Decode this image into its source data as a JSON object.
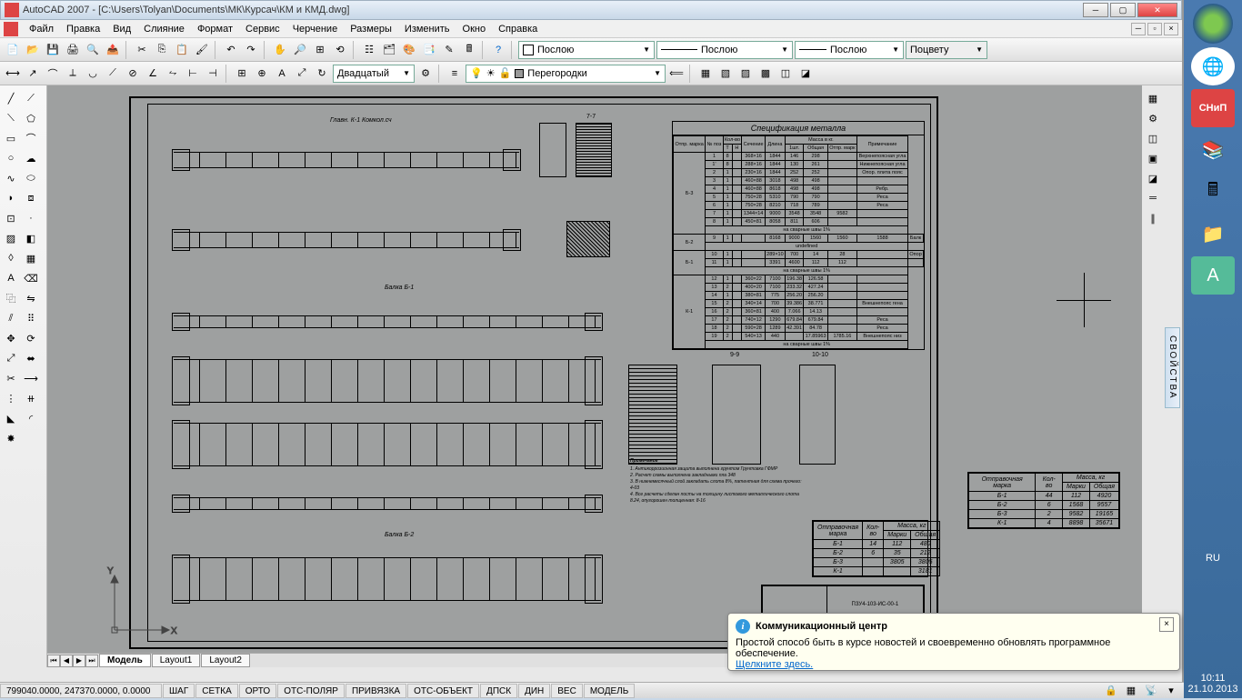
{
  "titlebar": {
    "text": "AutoCAD 2007 - [C:\\Users\\Tolyan\\Documents\\МК\\Курсач\\КМ и КМД.dwg]"
  },
  "menu": [
    "Файл",
    "Правка",
    "Вид",
    "Слияние",
    "Формат",
    "Сервис",
    "Черчение",
    "Размеры",
    "Изменить",
    "Окно",
    "Справка"
  ],
  "properties_row": {
    "color": "Послою",
    "linetype": "Послою",
    "lineweight": "Послою",
    "plotstyle": "Поцвету"
  },
  "layer_row": {
    "dimstyle": "Двадцатый",
    "layer": "Перегородки"
  },
  "tabs": [
    "Модель",
    "Layout1",
    "Layout2"
  ],
  "active_tab": 0,
  "status": {
    "coords": "799040.0000, 247370.0000, 0.0000",
    "toggles": [
      "ШАГ",
      "СЕТКА",
      "ОРТО",
      "ОТС-ПОЛЯР",
      "ПРИВЯЗКА",
      "ОТС-ОБЪЕКТ",
      "ДПСК",
      "ДИН",
      "ВЕС",
      "МОДЕЛЬ"
    ]
  },
  "notification": {
    "title": "Коммуникационный центр",
    "body": "Простой способ быть в курсе новостей и своевременно обновлять программное обеспечение.",
    "link": "Щелкните здесь."
  },
  "properties_panel": "СВОЙСТВА",
  "clock": {
    "time": "10:11",
    "date": "21.10.2013"
  },
  "lang": "RU",
  "drawing": {
    "spec_title": "Спецификация металла",
    "spec_headers": [
      "Отпр. марка",
      "№ поз",
      "Кол-во",
      "",
      "Сечение",
      "Длина",
      "Масса в кг.",
      "",
      "",
      "Примечание"
    ],
    "spec_sub_headers": [
      "",
      "",
      "Т",
      "Н",
      "",
      "",
      "1шт.",
      "Общая",
      "Отпр. марк",
      ""
    ],
    "spec_groups": [
      {
        "mark": "Б-3",
        "rows": [
          [
            "1",
            "8",
            "",
            "368×16",
            "1844",
            "146",
            "298",
            "",
            "Верхнепоясная угла"
          ],
          [
            "1'",
            "8",
            "",
            "288×16",
            "1844",
            "130",
            "261",
            "",
            "Нижнепоясная угла"
          ],
          [
            "2",
            "1",
            "",
            "230×16",
            "1844",
            "252",
            "252",
            "",
            "Опор. плита пояс"
          ],
          [
            "3",
            "1",
            "",
            "460×88",
            "3018",
            "498",
            "498",
            "",
            ""
          ],
          [
            "4",
            "1",
            "",
            "460×88",
            "8618",
            "498",
            "498",
            "",
            "Ребр."
          ],
          [
            "5",
            "1",
            "",
            "750×28",
            "5310",
            "790",
            "790",
            "",
            "Реса"
          ],
          [
            "6",
            "1",
            "",
            "750×28",
            "8210",
            "718",
            "789",
            "",
            "Реса"
          ],
          [
            "7",
            "1",
            "",
            "1344×14",
            "9000",
            "3548",
            "3548",
            "9582",
            ""
          ],
          [
            "8",
            "1",
            "",
            "450×81",
            "8058",
            "811",
            "606",
            "",
            ""
          ]
        ],
        "footer": "на сварные швы 1%"
      },
      {
        "mark": "Б-2",
        "rows": [
          [
            "9",
            "1",
            "",
            "",
            "8168",
            "9000",
            "1560",
            "1560",
            "1588",
            "Балк"
          ]
        ]
      },
      {
        "mark": "Б-1",
        "rows": [
          [
            "10",
            "1",
            "",
            "",
            "289×10",
            "700",
            "14",
            "28",
            "",
            "Опор"
          ],
          [
            "11",
            "1",
            "",
            "",
            "3391",
            "4600",
            "112",
            "112",
            "",
            ""
          ]
        ],
        "footer": "на сварные швы 1%"
      },
      {
        "mark": "К-1",
        "rows": [
          [
            "12",
            "1",
            "",
            "360×22",
            "7100",
            "196.38",
            "126.58",
            "",
            ""
          ],
          [
            "13",
            "2",
            "",
            "400×20",
            "7100",
            "233.32",
            "427.24",
            "",
            ""
          ],
          [
            "14",
            "1",
            "",
            "380×81",
            "775",
            "256.20",
            "256.20",
            "",
            ""
          ],
          [
            "15",
            "2",
            "",
            "340×14",
            "700",
            "39.386",
            "38.771",
            "",
            "Внешнепояс гена"
          ],
          [
            "16",
            "2",
            "",
            "360×81",
            "400",
            "7.066",
            "14.13",
            "",
            ""
          ],
          [
            "17",
            "2",
            "",
            "740×12",
            "1290",
            "679.84",
            "679.84",
            "",
            "Реса"
          ],
          [
            "18",
            "2",
            "",
            "590×28",
            "1289",
            "42.391",
            "84.78",
            "",
            "Реса"
          ],
          [
            "19",
            "2",
            "",
            "540×13",
            "440",
            "",
            "17.85963",
            "1785.16",
            "Внешнепояс низ"
          ]
        ],
        "footer": "на сварные швы 1%"
      }
    ],
    "notes_title": "Примечание",
    "notes": [
      "1. Антикоррозионная защита выполнена грунтом Грунтовка ГФМР",
      "2. Расчет схемы выполнена закладными пла 348",
      "3. В нижнемесячный слой закладать слота 8%, патентная для схема прочего: 4-03",
      "4. Все расчеты сделан посты на толщину листового металлического слота 8.24, опугорошен толщенная: 8-16"
    ],
    "mass_table1": {
      "headers": [
        "Отправочная марка",
        "Кол-во",
        "Масса, кг"
      ],
      "sub_headers": [
        "",
        "",
        "Марки",
        "Общая"
      ],
      "rows": [
        [
          "Б-1",
          "14",
          "112",
          "480"
        ],
        [
          "Б-2",
          "6",
          "35",
          "212"
        ],
        [
          "Б-3",
          "",
          "3805",
          "3805"
        ],
        [
          "К-1",
          "",
          "",
          "3181"
        ]
      ]
    },
    "mass_table2": {
      "headers": [
        "Отправочная марка",
        "Кол-во",
        "Масса, кг"
      ],
      "sub_headers": [
        "",
        "",
        "Марки",
        "Общая"
      ],
      "rows": [
        [
          "Б-1",
          "44",
          "112",
          "4920"
        ],
        [
          "Б-2",
          "6",
          "1568",
          "9557"
        ],
        [
          "Б-3",
          "2",
          "9582",
          "19165"
        ],
        [
          "К-1",
          "4",
          "8898",
          "35671"
        ]
      ]
    },
    "title_block_num": "ПЗУ4-103-ИС-00-1",
    "section_labels": [
      "7-7",
      "9-9",
      "10-10"
    ],
    "view_labels": [
      "Главн. К-1 Комкол.сч",
      "Балка Б-1",
      "Балка Б-2"
    ]
  }
}
